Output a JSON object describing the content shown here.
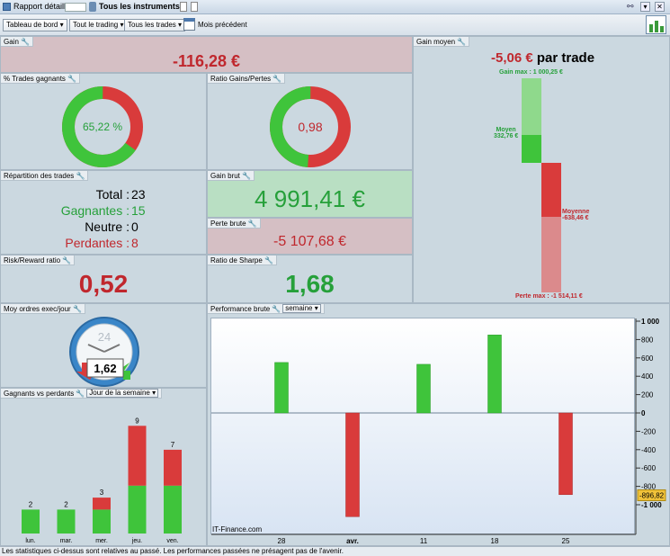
{
  "titlebar": {
    "title": "Rapport détaillé",
    "instruments": "Tous les instruments"
  },
  "toolbar": {
    "dashboard": "Tableau de bord",
    "trading": "Tout le trading",
    "trades": "Tous les trades",
    "period": "Mois précédent"
  },
  "gain": {
    "label": "Gain",
    "value": "-116,28 €"
  },
  "pct_win": {
    "label": "% Trades gagnants",
    "value": "65,22 %",
    "fraction": 0.6522
  },
  "ratio_gp": {
    "label": "Ratio Gains/Pertes",
    "value": "0,98",
    "fraction": 0.49
  },
  "repartition": {
    "label": "Répartition des trades",
    "total_label": "Total :",
    "total": "23",
    "win_label": "Gagnantes :",
    "win": "15",
    "neutral_label": "Neutre :",
    "neutral": "0",
    "loss_label": "Perdantes :",
    "loss": "8"
  },
  "gain_brut": {
    "label": "Gain brut",
    "value": "4 991,41 €"
  },
  "perte_brute": {
    "label": "Perte brute",
    "value": "-5 107,68 €"
  },
  "rr": {
    "label": "Risk/Reward ratio",
    "value": "0,52"
  },
  "sharpe": {
    "label": "Ratio de Sharpe",
    "value": "1,68"
  },
  "gain_moyen": {
    "label": "Gain moyen",
    "value": "-5,06 €",
    "suffix": "par trade",
    "gain_max_label": "Gain max :",
    "gain_max": "1 000,25 €",
    "moyen_label": "Moyen",
    "moyen": "332,76 €",
    "moyenne_label": "Moyenne",
    "moyenne": "-638,46 €",
    "perte_max_label": "Perte max :",
    "perte_max": "-1 514,11 €"
  },
  "ordres": {
    "label": "Moy ordres exec/jour",
    "clock_number": "24",
    "value": "1,62"
  },
  "gagnants": {
    "label": "Gagnants vs perdants",
    "dropdown": "Jour de la semaine",
    "days": [
      {
        "name": "lun.",
        "total": "2",
        "win": 2,
        "loss": 0
      },
      {
        "name": "mar.",
        "total": "2",
        "win": 2,
        "loss": 0
      },
      {
        "name": "mer.",
        "total": "3",
        "win": 2,
        "loss": 1
      },
      {
        "name": "jeu.",
        "total": "9",
        "win": 4,
        "loss": 5
      },
      {
        "name": "ven.",
        "total": "7",
        "win": 4,
        "loss": 3
      }
    ]
  },
  "perf": {
    "label": "Performance brute",
    "dropdown": "semaine",
    "credit": "IT-Finance.com",
    "current_label": "-896,82",
    "chart_data": {
      "type": "bar",
      "ylim": [
        -1100,
        1000
      ],
      "yticks": [
        "1 000",
        "800",
        "600",
        "400",
        "200",
        "0",
        "-200",
        "-400",
        "-600",
        "-800",
        "-1 000"
      ],
      "categories": [
        "28",
        "avr.",
        "11",
        "18",
        "25"
      ],
      "values": [
        550,
        -1130,
        530,
        850,
        -890
      ],
      "current_value": -896.82
    }
  },
  "status": {
    "text": "Les statistiques ci-dessus sont relatives au passé. Les performances passées ne présagent pas de l'avenir."
  }
}
